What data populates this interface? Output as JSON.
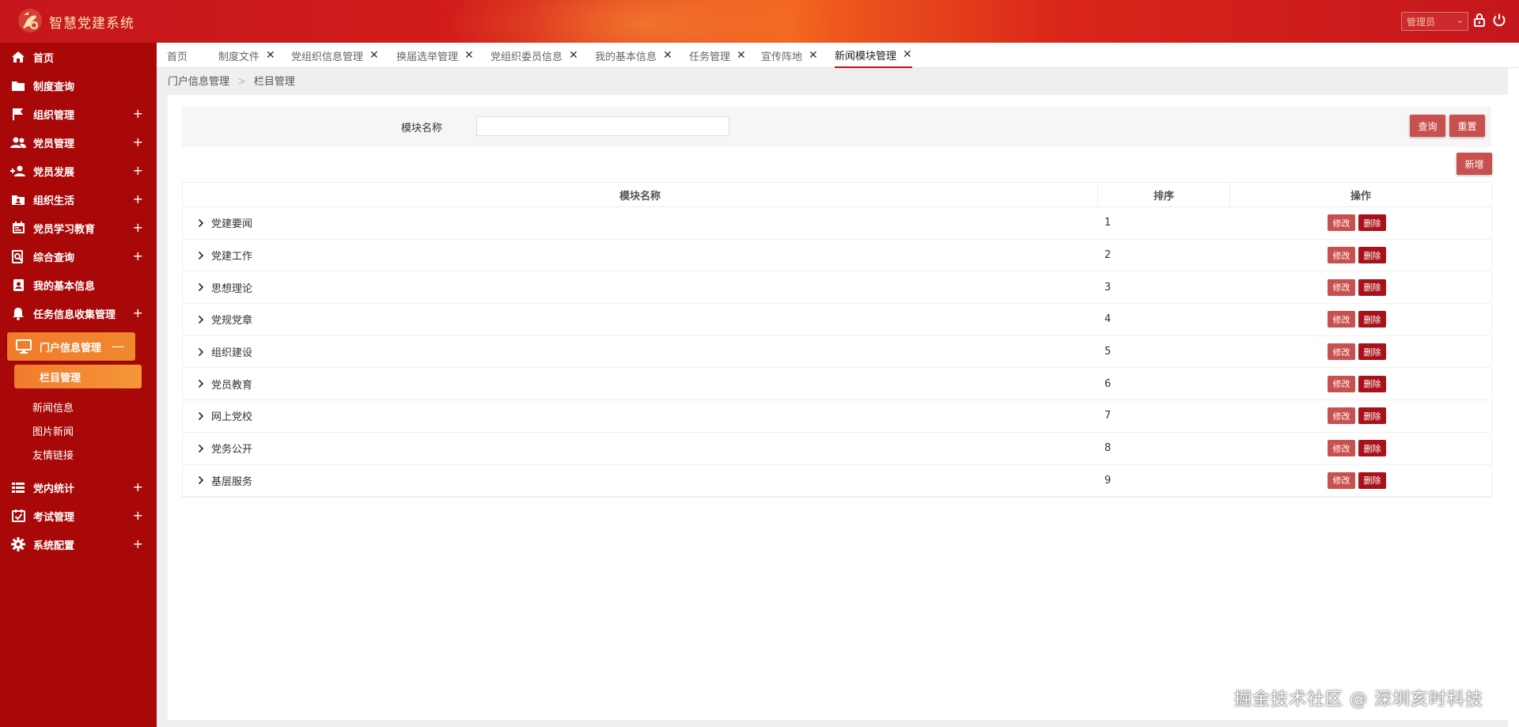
{
  "app": {
    "title": "智慧党建系统"
  },
  "header": {
    "role_select": "管理员"
  },
  "sidebar": {
    "items": [
      {
        "label": "首页",
        "icon": "home-icon",
        "expandable": false
      },
      {
        "label": "制度查询",
        "icon": "folder-icon",
        "expandable": false
      },
      {
        "label": "组织管理",
        "icon": "flag-icon",
        "expandable": true
      },
      {
        "label": "党员管理",
        "icon": "users-icon",
        "expandable": true
      },
      {
        "label": "党员发展",
        "icon": "user-plus-icon",
        "expandable": true
      },
      {
        "label": "组织生活",
        "icon": "folder-user-icon",
        "expandable": true
      },
      {
        "label": "党员学习教育",
        "icon": "calendar-icon",
        "expandable": true
      },
      {
        "label": "综合查询",
        "icon": "search-doc-icon",
        "expandable": true
      },
      {
        "label": "我的基本信息",
        "icon": "id-card-icon",
        "expandable": false
      },
      {
        "label": "任务信息收集管理",
        "icon": "bell-icon",
        "expandable": true
      }
    ],
    "active_group": {
      "label": "门户信息管理",
      "icon": "monitor-icon",
      "toggle": "—"
    },
    "sub_items": {
      "active": "栏目管理",
      "others": [
        "新闻信息",
        "图片新闻",
        "友情链接"
      ]
    },
    "bottom_items": [
      {
        "label": "党内统计",
        "icon": "list-icon"
      },
      {
        "label": "考试管理",
        "icon": "calendar-check-icon"
      },
      {
        "label": "系统配置",
        "icon": "gear-icon"
      }
    ],
    "plus_symbol": "+"
  },
  "tabs": [
    {
      "label": "首页",
      "closable": false
    },
    {
      "label": "制度文件",
      "closable": true
    },
    {
      "label": "党组织信息管理",
      "closable": true
    },
    {
      "label": "换届选举管理",
      "closable": true
    },
    {
      "label": "党组织委员信息",
      "closable": true
    },
    {
      "label": "我的基本信息",
      "closable": true
    },
    {
      "label": "任务管理",
      "closable": true
    },
    {
      "label": "宣传阵地",
      "closable": true
    },
    {
      "label": "新闻模块管理",
      "closable": true,
      "active": true
    }
  ],
  "breadcrumb": {
    "parent": "门户信息管理",
    "separator": ">",
    "current": "栏目管理"
  },
  "search": {
    "label": "模块名称",
    "value": "",
    "query_button": "查询",
    "reset_button": "重置"
  },
  "add_button": "新增",
  "table": {
    "columns": [
      "模块名称",
      "排序",
      "操作"
    ],
    "rows": [
      {
        "name": "党建要闻",
        "order": "1"
      },
      {
        "name": "党建工作",
        "order": "2"
      },
      {
        "name": "思想理论",
        "order": "3"
      },
      {
        "name": "党规党章",
        "order": "4"
      },
      {
        "name": "组织建设",
        "order": "5"
      },
      {
        "name": "党员教育",
        "order": "6"
      },
      {
        "name": "网上党校",
        "order": "7"
      },
      {
        "name": "党务公开",
        "order": "8"
      },
      {
        "name": "基层服务",
        "order": "9"
      }
    ],
    "edit_label": "修改",
    "delete_label": "删除"
  },
  "watermark": "掘金技术社区 @ 深圳亥时科技",
  "colors": {
    "header_red": "#c4161c",
    "sidebar_red": "#a80808",
    "active_orange": "#f07b2c",
    "edit_btn": "#c8514f",
    "delete_btn": "#a8121a"
  }
}
